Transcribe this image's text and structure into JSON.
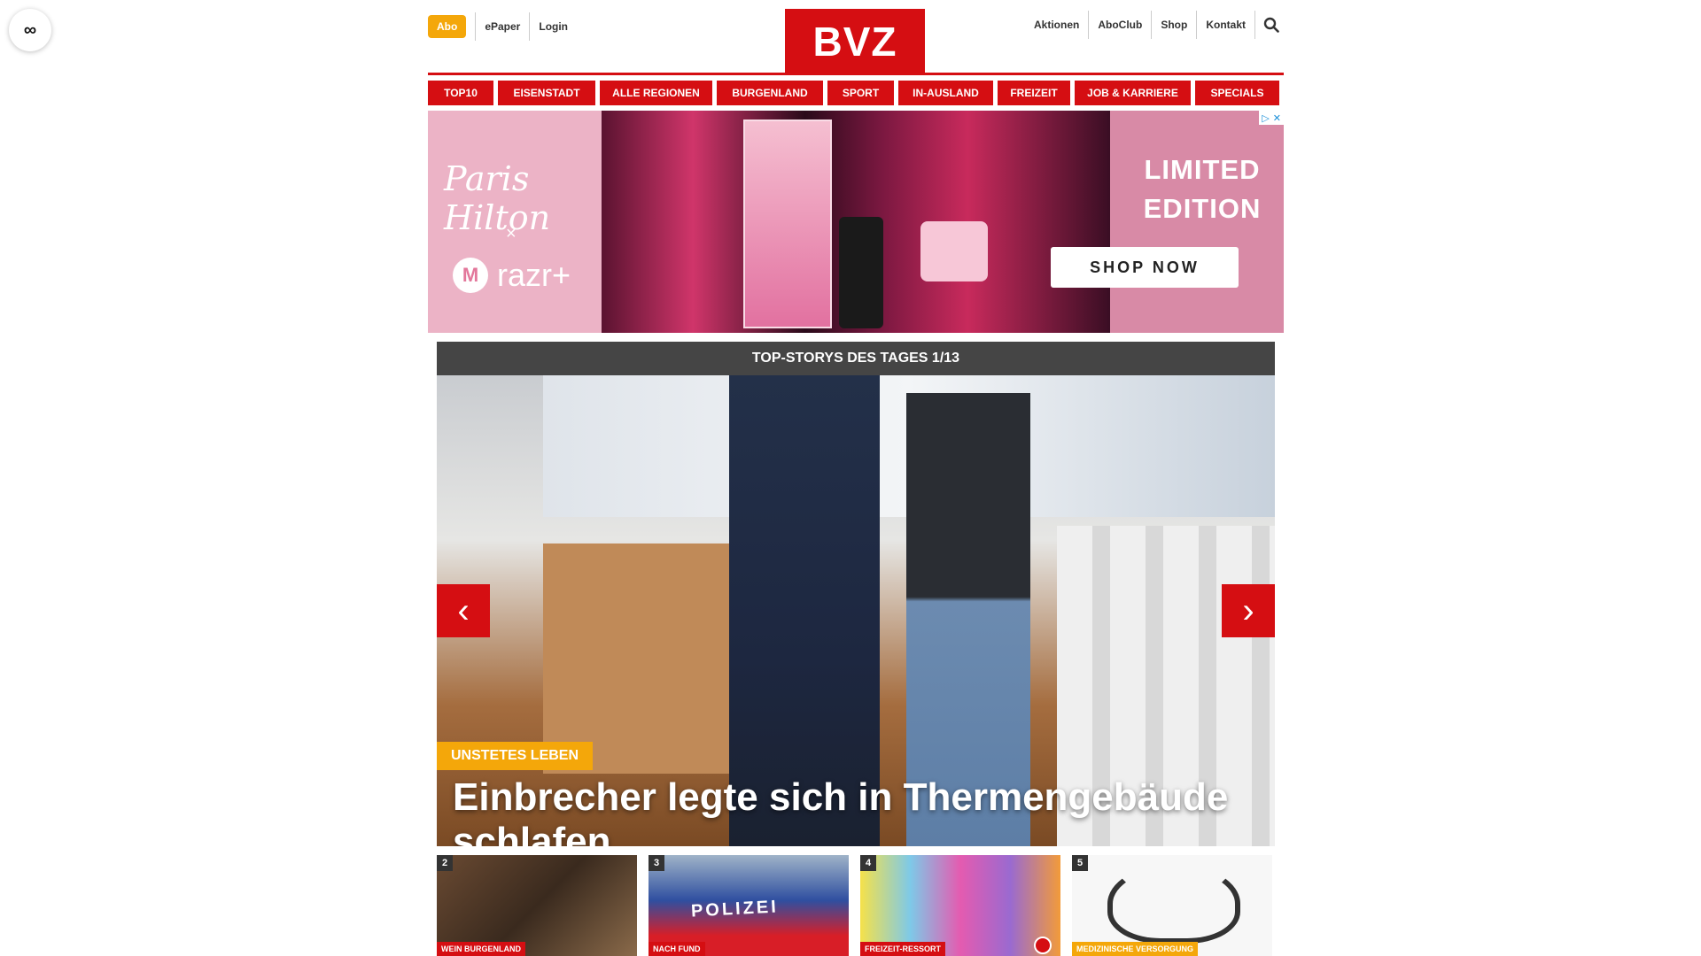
{
  "side_button": {
    "icon": "infinity-icon",
    "glyph": "∞"
  },
  "header": {
    "abo_label": "Abo",
    "left_links": [
      "ePaper",
      "Login"
    ],
    "logo_text": "BVZ",
    "right_links": [
      "Aktionen",
      "AboClub",
      "Shop",
      "Kontakt"
    ],
    "search_icon": "search-icon"
  },
  "nav": {
    "items": [
      "TOP10",
      "EISENSTADT",
      "ALLE REGIONEN",
      "BURGENLAND",
      "SPORT",
      "IN-AUSLAND",
      "FREIZEIT",
      "JOB & KARRIERE",
      "SPECIALS"
    ]
  },
  "ad": {
    "brand1": "Paris Hilton",
    "x": "×",
    "brand2": "razr+",
    "headline_line1": "LIMITED",
    "headline_line2": "EDITION",
    "cta": "SHOP NOW"
  },
  "top_stories": {
    "heading": "TOP-STORYS DES TAGES 1/13",
    "prev_glyph": "‹",
    "next_glyph": "›",
    "tag": "UNSTETES LEBEN",
    "title": "Einbrecher legte sich in Thermengebäude schlafen"
  },
  "thumbnails": [
    {
      "num": "2",
      "tag": "WEIN BURGENLAND"
    },
    {
      "num": "3",
      "tag": "NACH FUND",
      "overlay": "POLIZEI"
    },
    {
      "num": "4",
      "tag": "FREIZEIT-RESSORT"
    },
    {
      "num": "5",
      "tag": "MEDIZINISCHE VERSORGUNG"
    }
  ]
}
